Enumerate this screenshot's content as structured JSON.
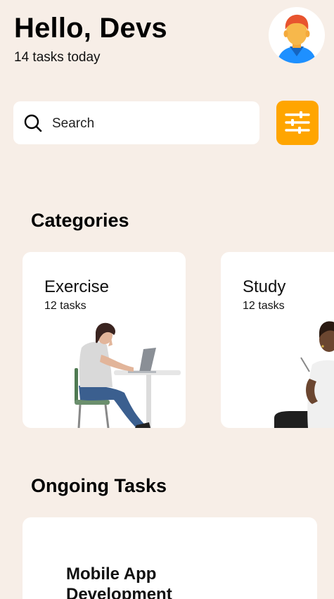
{
  "header": {
    "greeting": "Hello, Devs",
    "subtitle": "14 tasks today",
    "avatar_icon": "user-avatar-icon"
  },
  "search": {
    "placeholder": "Search",
    "icon": "search-icon",
    "filter_icon": "sliders-icon"
  },
  "categories": {
    "title": "Categories",
    "items": [
      {
        "name": "Exercise",
        "count": "12 tasks"
      },
      {
        "name": "Study",
        "count": "12 tasks"
      }
    ]
  },
  "ongoing": {
    "title": "Ongoing Tasks",
    "tasks": [
      {
        "title": "Mobile App Development"
      }
    ]
  },
  "colors": {
    "background": "#f7eee7",
    "accent": "#ffa500",
    "card": "#ffffff"
  }
}
